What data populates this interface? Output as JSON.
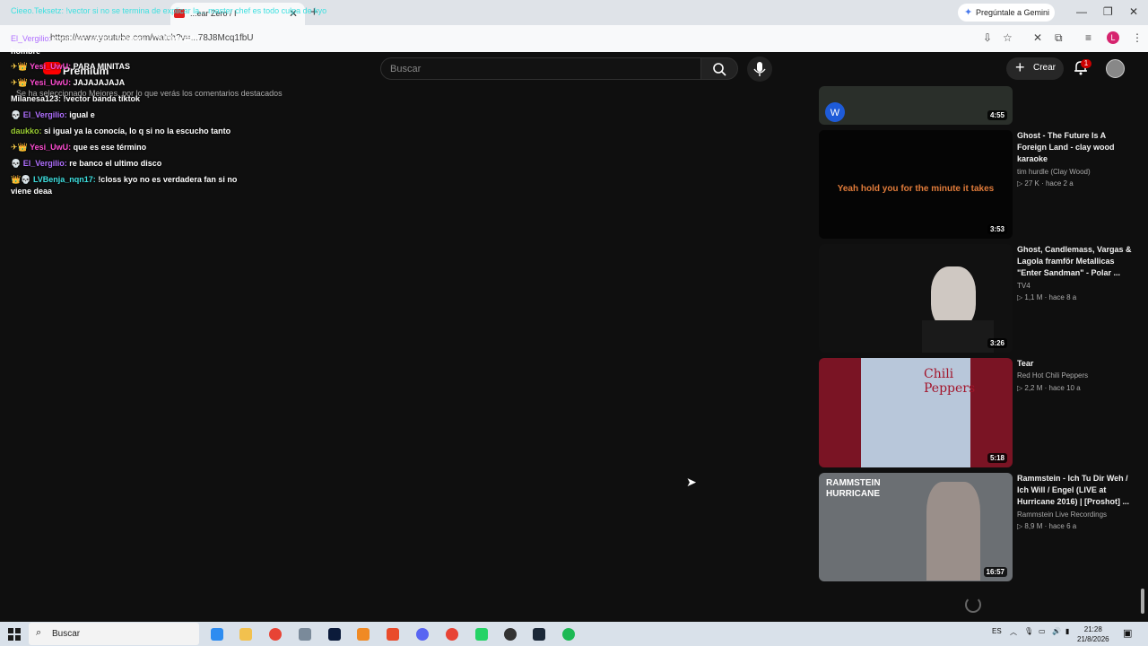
{
  "browser": {
    "tab_title": "...ear Zero / I",
    "gemini_label": "Pregúntale a Gemini",
    "url_partial": "https://www.youtube.com/watch?v=...78J8Mcq1fbU",
    "profile_initial": "L"
  },
  "youtube": {
    "brand": "Premium",
    "search_placeholder": "Buscar",
    "create_label": "Crear",
    "notifications_count": "1"
  },
  "chat": {
    "top_garbled": "Cieeo.Teksetz: !vector si no se termina de explicar la... master chef es todo culpa de kyo",
    "top_url_user": "El_Vergilio:",
    "top_url_text": "como dijo vector portman ...78J8Mcq1fbU",
    "hombre": "hombre",
    "banner": "Se ha seleccionado Mejores, por lo que verás los comentarios destacados",
    "messages": [
      {
        "user": "Yesi_UwU:",
        "text": "PARA MINITAS",
        "color": "pink",
        "badge": "✈👑"
      },
      {
        "user": "Yesi_UwU:",
        "text": "JAJAJAJAJA",
        "color": "pink",
        "badge": "✈👑"
      },
      {
        "user": "Milanesa123:",
        "text": "!vector banda tiktok",
        "color": "white",
        "badge": ""
      },
      {
        "user": "El_Vergilio:",
        "text": "igual e",
        "color": "purple",
        "badge": "💀"
      },
      {
        "user": "daukko:",
        "text": "si igual ya la conocía, lo q si no la escucho tanto",
        "color": "green",
        "badge": ""
      },
      {
        "user": "Yesi_UwU:",
        "text": "que es ese término",
        "color": "pink",
        "badge": "✈👑"
      },
      {
        "user": "El_Vergilio:",
        "text": "re banco el ultimo disco",
        "color": "purple",
        "badge": "💀"
      },
      {
        "user": "LVBenja_nqn17:",
        "text": "!closs kyo no es verdadera fan si no",
        "color": "cyan",
        "badge": "👑💀"
      },
      {
        "user": "",
        "text": "viene deaa",
        "color": "white",
        "badge": ""
      }
    ]
  },
  "videos": [
    {
      "title": "",
      "channel": "",
      "meta": "",
      "duration": "4:55",
      "thumb_text": ""
    },
    {
      "title": "Ghost - The Future Is A Foreign Land - clay wood karaoke",
      "channel": "tim hurdle (Clay Wood)",
      "views": "27 K",
      "age": "hace 2 a",
      "duration": "3:53",
      "thumb_text": "Yeah hold you for the minute it takes"
    },
    {
      "title": "Ghost, Candlemass, Vargas & Lagola framför Metallicas \"Enter Sandman\" - Polar ...",
      "channel": "TV4",
      "views": "1,1 M",
      "age": "hace 8 a",
      "duration": "3:26",
      "thumb_text": ""
    },
    {
      "title": "Tear",
      "channel": "Red Hot Chili Peppers",
      "views": "2,2 M",
      "age": "hace 10 a",
      "duration": "5:18",
      "thumb_text": "Chili Peppers"
    },
    {
      "title": "Rammstein - Ich Tu Dir Weh / Ich Will / Engel (LIVE at Hurricane 2016) | [Proshot] ...",
      "channel": "Rammstein Live Recordings",
      "views": "8,9 M",
      "age": "hace 6 a",
      "duration": "16:57",
      "thumb_text": "RAMMSTEIN HURRICANE"
    }
  ],
  "taskbar": {
    "search_label": "Buscar",
    "lang": "ES",
    "time": "21:28",
    "date": "21/8/2026"
  },
  "colors": {
    "bg": "#0f0f0f",
    "yt_red": "#ff0000",
    "chat_purple": "#b070ff",
    "chat_pink": "#ff4dd2",
    "chat_green": "#9acd32",
    "chat_cyan": "#3ee0e0"
  }
}
